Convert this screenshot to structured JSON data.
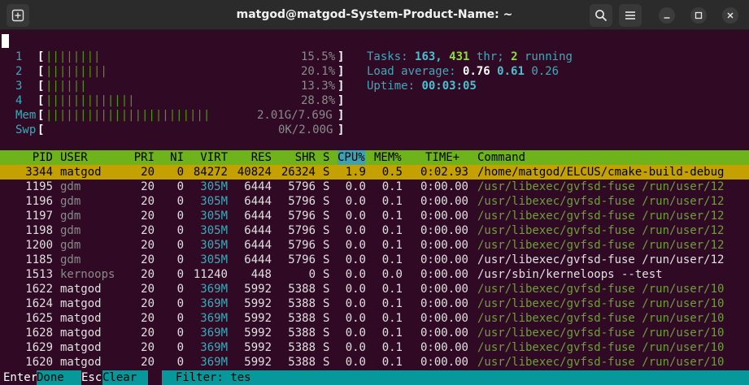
{
  "window": {
    "title": "matgod@matgod-System-Product-Name: ~"
  },
  "meters": {
    "cpus": [
      {
        "label": "1",
        "bar": "||||||||",
        "value": "15.5%"
      },
      {
        "label": "2",
        "bar": "|||||||||",
        "value": "20.1%"
      },
      {
        "label": "3",
        "bar": "||||||",
        "value": "13.3%"
      },
      {
        "label": "4",
        "bar": "|||||||||||||",
        "value": "28.8%"
      }
    ],
    "mem": {
      "label": "Mem",
      "bar": "||||||||||||||||||||||||",
      "value": "2.01G/7.69G"
    },
    "swp": {
      "label": "Swp",
      "bar": "",
      "value": "0K/2.00G"
    }
  },
  "stats": {
    "tasks_label": "Tasks:",
    "tasks": "163,",
    "threads": "431",
    "threads_label": "thr;",
    "running": "2",
    "running_label": "running",
    "load_label": "Load average:",
    "load1": "0.76",
    "load5": "0.61",
    "load15": "0.26",
    "uptime_label": "Uptime:",
    "uptime": "00:03:05"
  },
  "table": {
    "headers": [
      "PID",
      "USER",
      "PRI",
      "NI",
      "VIRT",
      "RES",
      "SHR",
      "S",
      "CPU%",
      "MEM%",
      "TIME+",
      "Command"
    ],
    "rows": [
      {
        "pid": "3344",
        "user": "matgod",
        "pri": "20",
        "ni": "0",
        "virt": "84272",
        "res": "40824",
        "shr": "26324",
        "s": "S",
        "cpu": "1.9",
        "mem": "0.5",
        "time": "0:02.93",
        "cmd": "/home/matgod/ELCUS/cmake-build-debug"
      },
      {
        "pid": "1195",
        "user": "gdm",
        "pri": "20",
        "ni": "0",
        "virt": "305M",
        "res": "6444",
        "shr": "5796",
        "s": "S",
        "cpu": "0.0",
        "mem": "0.1",
        "time": "0:00.00",
        "cmd": "/usr/libexec/gvfsd-fuse /run/user/12"
      },
      {
        "pid": "1196",
        "user": "gdm",
        "pri": "20",
        "ni": "0",
        "virt": "305M",
        "res": "6444",
        "shr": "5796",
        "s": "S",
        "cpu": "0.0",
        "mem": "0.1",
        "time": "0:00.00",
        "cmd": "/usr/libexec/gvfsd-fuse /run/user/12"
      },
      {
        "pid": "1197",
        "user": "gdm",
        "pri": "20",
        "ni": "0",
        "virt": "305M",
        "res": "6444",
        "shr": "5796",
        "s": "S",
        "cpu": "0.0",
        "mem": "0.1",
        "time": "0:00.00",
        "cmd": "/usr/libexec/gvfsd-fuse /run/user/12"
      },
      {
        "pid": "1198",
        "user": "gdm",
        "pri": "20",
        "ni": "0",
        "virt": "305M",
        "res": "6444",
        "shr": "5796",
        "s": "S",
        "cpu": "0.0",
        "mem": "0.1",
        "time": "0:00.00",
        "cmd": "/usr/libexec/gvfsd-fuse /run/user/12"
      },
      {
        "pid": "1200",
        "user": "gdm",
        "pri": "20",
        "ni": "0",
        "virt": "305M",
        "res": "6444",
        "shr": "5796",
        "s": "S",
        "cpu": "0.0",
        "mem": "0.1",
        "time": "0:00.00",
        "cmd": "/usr/libexec/gvfsd-fuse /run/user/12"
      },
      {
        "pid": "1185",
        "user": "gdm",
        "pri": "20",
        "ni": "0",
        "virt": "305M",
        "res": "6444",
        "shr": "5796",
        "s": "S",
        "cpu": "0.0",
        "mem": "0.1",
        "time": "0:00.00",
        "cmd": "/usr/libexec/gvfsd-fuse /run/user/12"
      },
      {
        "pid": "1513",
        "user": "kernoops",
        "pri": "20",
        "ni": "0",
        "virt": "11240",
        "res": "448",
        "shr": "0",
        "s": "S",
        "cpu": "0.0",
        "mem": "0.0",
        "time": "0:00.00",
        "cmd": "/usr/sbin/kerneloops --test"
      },
      {
        "pid": "1622",
        "user": "matgod",
        "pri": "20",
        "ni": "0",
        "virt": "369M",
        "res": "5992",
        "shr": "5388",
        "s": "S",
        "cpu": "0.0",
        "mem": "0.1",
        "time": "0:00.00",
        "cmd": "/usr/libexec/gvfsd-fuse /run/user/10"
      },
      {
        "pid": "1624",
        "user": "matgod",
        "pri": "20",
        "ni": "0",
        "virt": "369M",
        "res": "5992",
        "shr": "5388",
        "s": "S",
        "cpu": "0.0",
        "mem": "0.1",
        "time": "0:00.00",
        "cmd": "/usr/libexec/gvfsd-fuse /run/user/10"
      },
      {
        "pid": "1625",
        "user": "matgod",
        "pri": "20",
        "ni": "0",
        "virt": "369M",
        "res": "5992",
        "shr": "5388",
        "s": "S",
        "cpu": "0.0",
        "mem": "0.1",
        "time": "0:00.00",
        "cmd": "/usr/libexec/gvfsd-fuse /run/user/10"
      },
      {
        "pid": "1628",
        "user": "matgod",
        "pri": "20",
        "ni": "0",
        "virt": "369M",
        "res": "5992",
        "shr": "5388",
        "s": "S",
        "cpu": "0.0",
        "mem": "0.1",
        "time": "0:00.00",
        "cmd": "/usr/libexec/gvfsd-fuse /run/user/10"
      },
      {
        "pid": "1629",
        "user": "matgod",
        "pri": "20",
        "ni": "0",
        "virt": "369M",
        "res": "5992",
        "shr": "5388",
        "s": "S",
        "cpu": "0.0",
        "mem": "0.1",
        "time": "0:00.00",
        "cmd": "/usr/libexec/gvfsd-fuse /run/user/10"
      },
      {
        "pid": "1620",
        "user": "matgod",
        "pri": "20",
        "ni": "0",
        "virt": "369M",
        "res": "5992",
        "shr": "5388",
        "s": "S",
        "cpu": "0.0",
        "mem": "0.1",
        "time": "0:00.00",
        "cmd": "/usr/libexec/gvfsd-fuse /run/user/10"
      }
    ]
  },
  "footer": {
    "key1": "Enter",
    "label1": "Done",
    "key2": "Esc",
    "label2": "Clear",
    "filter_label": "Filter:",
    "filter_value": "tes"
  },
  "colors": {
    "terminal_bg": "#300a24",
    "header_bg": "#6fb31c",
    "selected_bg": "#c4a000",
    "footer_bar_bg": "#06989a"
  },
  "icons": {
    "new_tab": "new-tab-icon",
    "search": "search-icon",
    "menu": "hamburger-menu-icon",
    "minimize": "minimize-icon",
    "maximize": "maximize-icon",
    "close": "close-icon"
  }
}
